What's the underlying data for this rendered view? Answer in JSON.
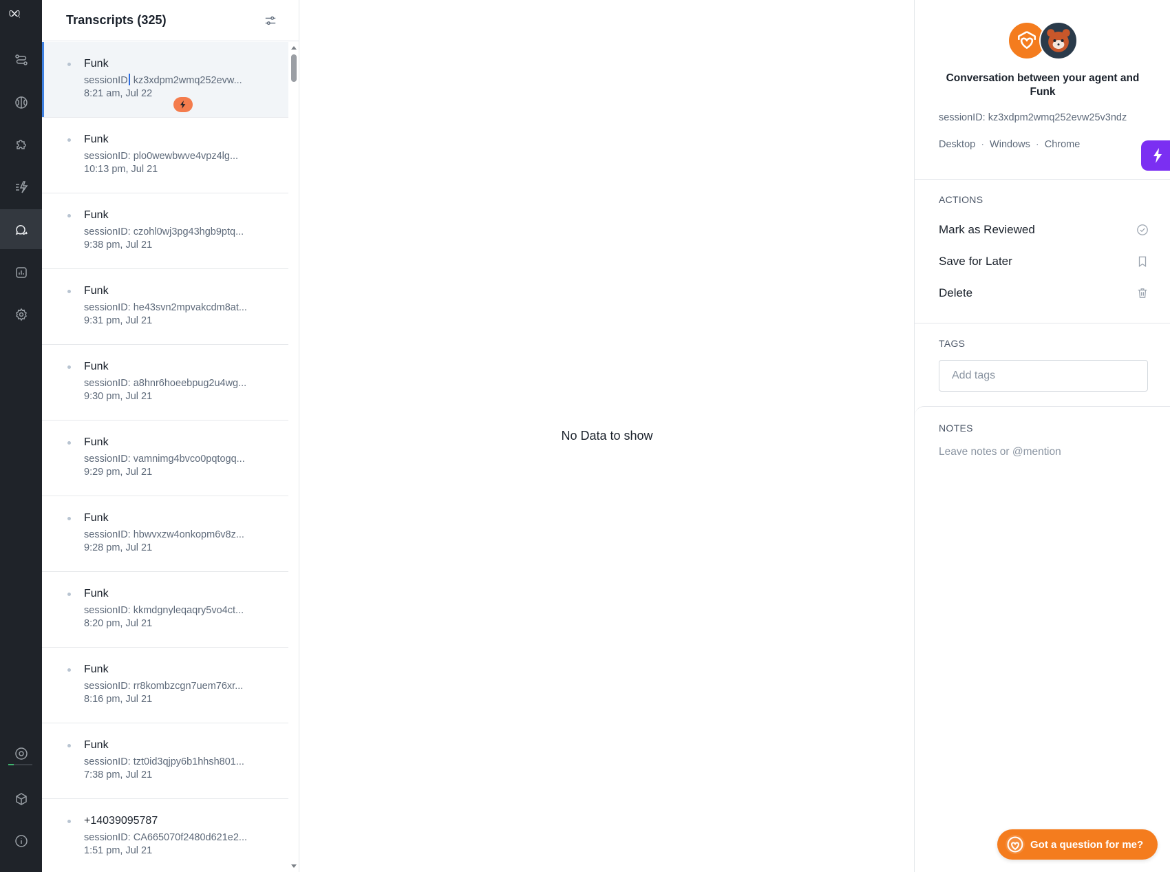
{
  "nav": {
    "items": [
      {
        "icon": "workflow-icon"
      },
      {
        "icon": "brain-icon"
      },
      {
        "icon": "puzzle-icon"
      },
      {
        "icon": "lightning-list-icon"
      },
      {
        "icon": "chat-bubbles-icon",
        "active": true
      },
      {
        "icon": "analytics-icon"
      },
      {
        "icon": "gear-icon"
      }
    ],
    "bottom": [
      {
        "icon": "target-icon"
      },
      {
        "icon": "cube-icon"
      },
      {
        "icon": "info-icon"
      }
    ]
  },
  "transcripts": {
    "title": "Transcripts (325)",
    "items": [
      {
        "name": "Funk",
        "session_prefix": "sessionID",
        "session_rest": " kz3xdpm2wmq252evw...",
        "time": "8:21 am, Jul 22"
      },
      {
        "name": "Funk",
        "session": "sessionID: plo0wewbwve4vpz4lg...",
        "time": "10:13 pm, Jul 21"
      },
      {
        "name": "Funk",
        "session": "sessionID: czohl0wj3pg43hgb9ptq...",
        "time": "9:38 pm, Jul 21"
      },
      {
        "name": "Funk",
        "session": "sessionID: he43svn2mpvakcdm8at...",
        "time": "9:31 pm, Jul 21"
      },
      {
        "name": "Funk",
        "session": "sessionID: a8hnr6hoeebpug2u4wg...",
        "time": "9:30 pm, Jul 21"
      },
      {
        "name": "Funk",
        "session": "sessionID: vamnimg4bvco0pqtogq...",
        "time": "9:29 pm, Jul 21"
      },
      {
        "name": "Funk",
        "session": "sessionID: hbwvxzw4onkopm6v8z...",
        "time": "9:28 pm, Jul 21"
      },
      {
        "name": "Funk",
        "session": "sessionID: kkmdgnyleqaqry5vo4ct...",
        "time": "8:20 pm, Jul 21"
      },
      {
        "name": "Funk",
        "session": "sessionID: rr8kombzcgn7uem76xr...",
        "time": "8:16 pm, Jul 21"
      },
      {
        "name": "Funk",
        "session": "sessionID: tzt0id3qjpy6b1hhsh801...",
        "time": "7:38 pm, Jul 21"
      },
      {
        "name": "+14039095787",
        "session": "sessionID: CA665070f2480d621e2...",
        "time": "1:51 pm, Jul 21"
      }
    ]
  },
  "center": {
    "empty_message": "No Data to show"
  },
  "detail": {
    "title": "Conversation between your agent and Funk",
    "session": "sessionID: kz3xdpm2wmq252evw25v3ndz",
    "platform": [
      "Desktop",
      "Windows",
      "Chrome"
    ],
    "actions_label": "ACTIONS",
    "actions": {
      "reviewed": "Mark as Reviewed",
      "save": "Save for Later",
      "delete": "Delete"
    },
    "tags_label": "TAGS",
    "tags_placeholder": "Add tags",
    "notes_label": "NOTES",
    "notes_placeholder": "Leave notes or @mention"
  },
  "help": {
    "label": "Got a question for me?"
  },
  "colors": {
    "rail_bg": "#1f2329",
    "brand_orange": "#f47c1e",
    "accent_blue": "#3d7fe0",
    "bolt_purple": "#7b2ff2"
  }
}
